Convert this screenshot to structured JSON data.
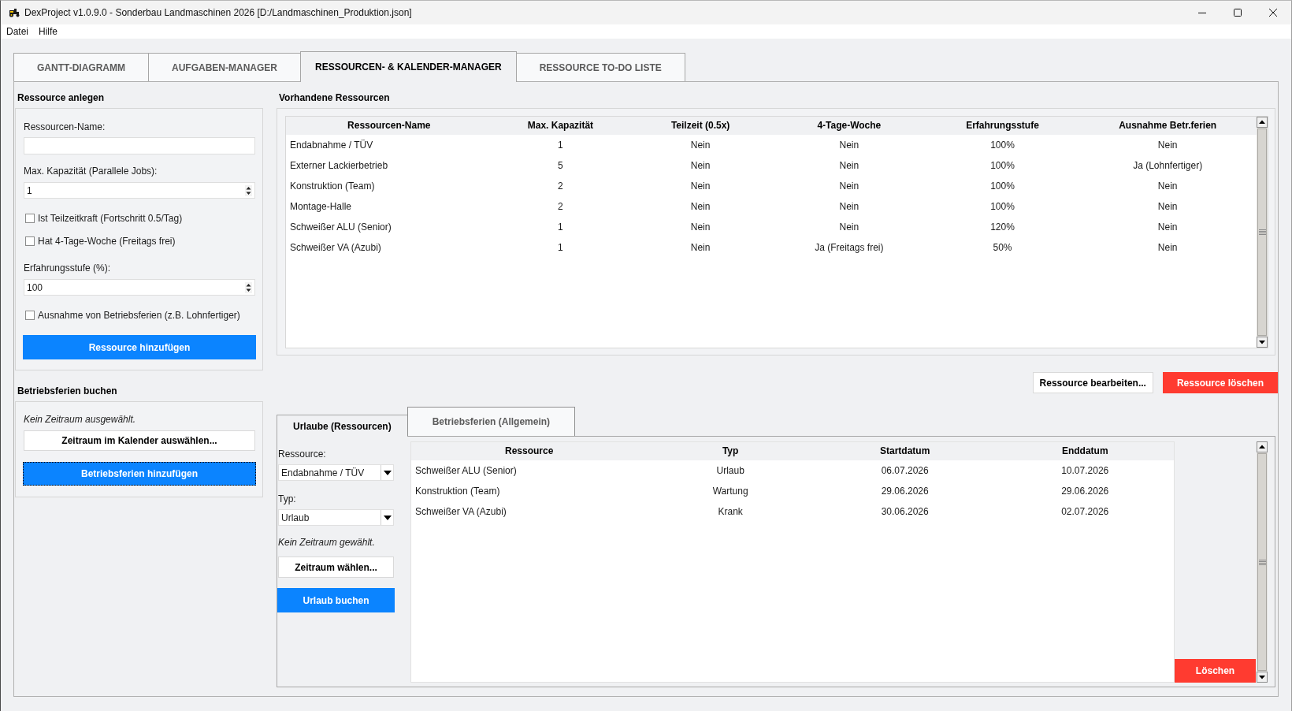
{
  "window": {
    "title": "DexProject v1.0.9.0 - Sonderbau Landmaschinen 2026 [D:/Landmaschinen_Produktion.json]"
  },
  "menu": [
    "Datei",
    "Hilfe"
  ],
  "tabs": [
    {
      "label": "GANTT-DIAGRAMM",
      "selected": false
    },
    {
      "label": "AUFGABEN-MANAGER",
      "selected": false
    },
    {
      "label": "RESSOURCEN- & KALENDER-MANAGER",
      "selected": true
    },
    {
      "label": "RESSOURCE TO-DO LISTE",
      "selected": false
    }
  ],
  "resource_form": {
    "title": "Ressource anlegen",
    "fields": [
      {
        "kind": "text",
        "label": "Ressourcen-Name:"
      },
      {
        "kind": "spin",
        "label": "Max. Kapazität (Parallele Jobs):",
        "value": "1"
      },
      {
        "kind": "checkbox",
        "label": "Ist Teilzeitkraft (Fortschritt 0.5/Tag)",
        "checked": false
      },
      {
        "kind": "checkbox",
        "label": "Hat 4-Tage-Woche (Freitags frei)",
        "checked": false
      },
      {
        "kind": "spin",
        "label": "Erfahrungsstufe (%):",
        "value": "100"
      },
      {
        "kind": "checkbox",
        "label": "Ausnahme von Betriebsferien (z.B. Lohnfertiger)",
        "checked": false
      }
    ],
    "button": {
      "label": "Ressource hinzufügen",
      "kind": "primary"
    }
  },
  "company_holidays": {
    "title": "Betriebsferien buchen",
    "status": "Kein Zeitraum ausgewählt.",
    "buttons": [
      {
        "label": "Zeitraum im Kalender auswählen...",
        "kind": "secondary",
        "focused": false
      },
      {
        "label": "Betriebsferien hinzufügen",
        "kind": "primary",
        "focused": true
      }
    ]
  },
  "resources": {
    "title": "Vorhandene Ressourcen",
    "table": {
      "columns": [
        "Ressourcen-Name",
        "Max. Kapazität",
        "Teilzeit (0.5x)",
        "4-Tage-Woche",
        "Erfahrungsstufe",
        "Ausnahme Betr.ferien"
      ],
      "rows": [
        [
          "Endabnahme / TÜV",
          "1",
          "Nein",
          "Nein",
          "100%",
          "Nein"
        ],
        [
          "Externer Lackierbetrieb",
          "5",
          "Nein",
          "Nein",
          "100%",
          "Ja (Lohnfertiger)"
        ],
        [
          "Konstruktion (Team)",
          "2",
          "Nein",
          "Nein",
          "100%",
          "Nein"
        ],
        [
          "Montage-Halle",
          "2",
          "Nein",
          "Nein",
          "100%",
          "Nein"
        ],
        [
          "Schweißer ALU (Senior)",
          "1",
          "Nein",
          "Nein",
          "120%",
          "Nein"
        ],
        [
          "Schweißer VA (Azubi)",
          "1",
          "Nein",
          "Ja (Freitags frei)",
          "50%",
          "Nein"
        ]
      ]
    },
    "buttons": [
      {
        "label": "Ressource bearbeiten...",
        "kind": "secondary"
      },
      {
        "label": "Ressource löschen",
        "kind": "danger"
      }
    ]
  },
  "absences": {
    "tabs": [
      {
        "label": "Urlaube (Ressourcen)",
        "selected": true
      },
      {
        "label": "Betriebsferien (Allgemein)",
        "selected": false
      }
    ],
    "form": {
      "fields": [
        {
          "kind": "dropdown",
          "label": "Ressource:",
          "value": "Endabnahme / TÜV"
        },
        {
          "kind": "dropdown",
          "label": "Typ:",
          "value": "Urlaub"
        }
      ],
      "status": "Kein Zeitraum gewählt.",
      "buttons": [
        {
          "label": "Zeitraum wählen...",
          "kind": "secondary"
        },
        {
          "label": "Urlaub buchen",
          "kind": "primary"
        }
      ]
    },
    "table": {
      "columns": [
        "Ressource",
        "Typ",
        "Startdatum",
        "Enddatum"
      ],
      "rows": [
        [
          "Schweißer ALU (Senior)",
          "Urlaub",
          "06.07.2026",
          "10.07.2026"
        ],
        [
          "Konstruktion (Team)",
          "Wartung",
          "29.06.2026",
          "29.06.2026"
        ],
        [
          "Schweißer VA (Azubi)",
          "Krank",
          "30.06.2026",
          "02.07.2026"
        ]
      ]
    },
    "delete_button": {
      "label": "Löschen",
      "kind": "danger"
    }
  }
}
